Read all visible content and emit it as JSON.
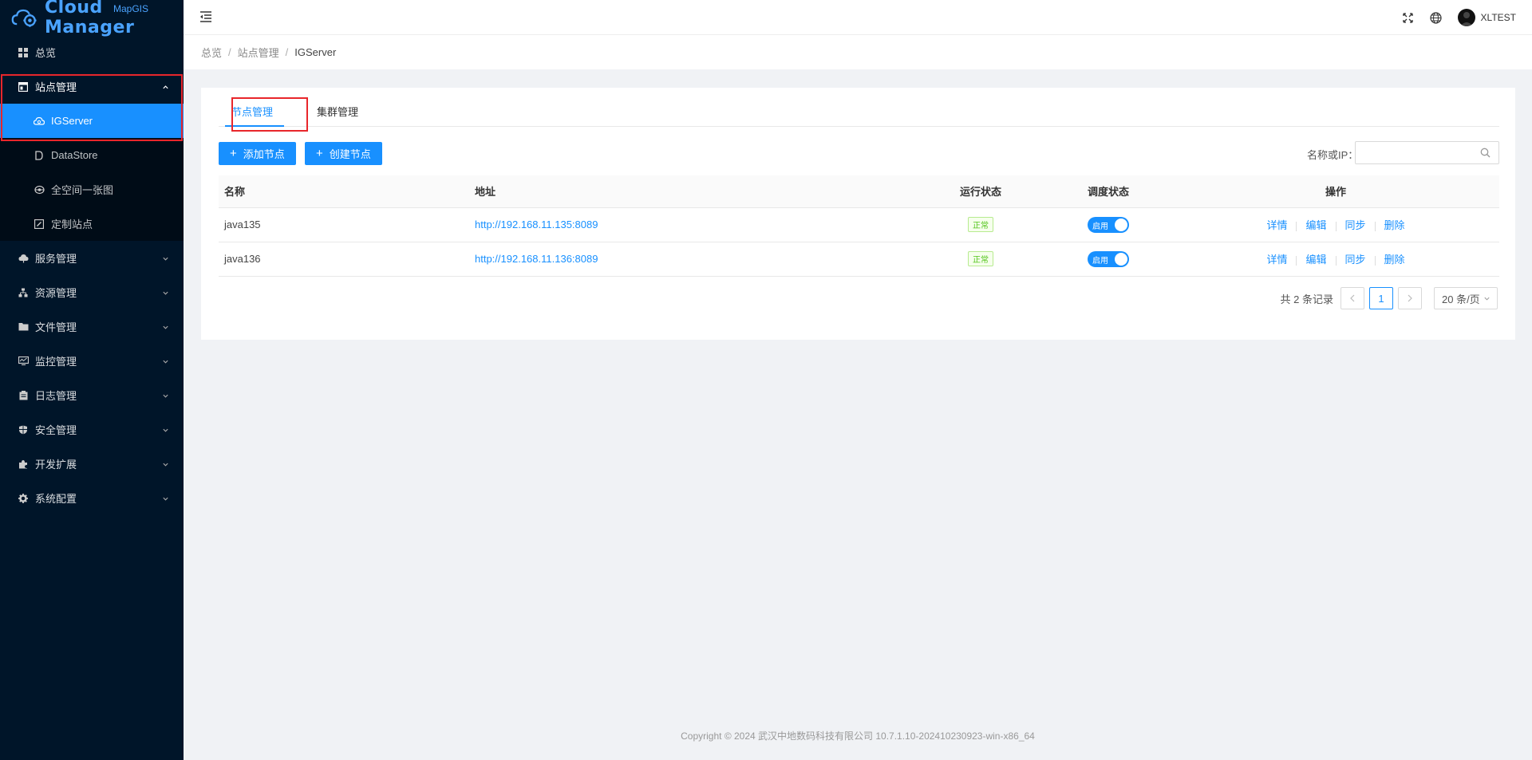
{
  "app": {
    "brand": "MapGIS",
    "logo_text": "Cloud Manager"
  },
  "sidebar": {
    "items": [
      {
        "label": "总览",
        "icon": "dashboard-icon"
      },
      {
        "label": "站点管理",
        "icon": "site-icon",
        "expanded": true,
        "children": [
          {
            "label": "IGServer",
            "icon": "cloud-server-icon",
            "active": true
          },
          {
            "label": "DataStore",
            "icon": "datastore-icon"
          },
          {
            "label": "全空间一张图",
            "icon": "globe-icon"
          },
          {
            "label": "定制站点",
            "icon": "custom-site-icon"
          }
        ]
      },
      {
        "label": "服务管理",
        "icon": "service-icon"
      },
      {
        "label": "资源管理",
        "icon": "resource-icon"
      },
      {
        "label": "文件管理",
        "icon": "folder-icon"
      },
      {
        "label": "监控管理",
        "icon": "monitor-icon"
      },
      {
        "label": "日志管理",
        "icon": "log-icon"
      },
      {
        "label": "安全管理",
        "icon": "shield-icon"
      },
      {
        "label": "开发扩展",
        "icon": "puzzle-icon"
      },
      {
        "label": "系统配置",
        "icon": "gear-icon"
      }
    ]
  },
  "header": {
    "username": "XLTEST"
  },
  "breadcrumb": [
    "总览",
    "站点管理",
    "IGServer"
  ],
  "tabs": [
    {
      "label": "节点管理",
      "active": true
    },
    {
      "label": "集群管理",
      "active": false
    }
  ],
  "toolbar": {
    "add_label": "添加节点",
    "create_label": "创建节点",
    "search_label": "名称或IP：",
    "search_value": ""
  },
  "table": {
    "headers": [
      "名称",
      "地址",
      "运行状态",
      "调度状态",
      "操作"
    ],
    "rows": [
      {
        "name": "java135",
        "address": "http://192.168.11.135:8089",
        "run_status": "正常",
        "schedule": "启用"
      },
      {
        "name": "java136",
        "address": "http://192.168.11.136:8089",
        "run_status": "正常",
        "schedule": "启用"
      }
    ],
    "actions": [
      "详情",
      "编辑",
      "同步",
      "删除"
    ]
  },
  "pagination": {
    "total_text": "共 2 条记录",
    "current_page": "1",
    "page_size": "20 条/页"
  },
  "footer": "Copyright © 2024 武汉中地数码科技有限公司 10.7.1.10-202410230923-win-x86_64",
  "colors": {
    "sidebar_bg": "#001529",
    "primary": "#1890ff",
    "highlight": "#e8262b",
    "success": "#52c41a"
  }
}
